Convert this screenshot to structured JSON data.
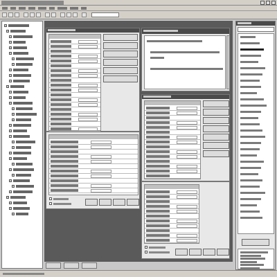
{
  "window": {
    "title": ""
  },
  "menu": {
    "items": [
      "",
      "",
      "",
      "",
      "",
      "",
      "",
      "",
      ""
    ]
  },
  "toolbar": {
    "button_count": 12
  },
  "project_tree": {
    "root": "",
    "nodes": [
      "",
      "",
      "",
      "",
      "",
      "",
      "",
      "",
      "",
      "",
      "",
      "",
      "",
      "",
      "",
      "",
      "",
      "",
      "",
      "",
      "",
      "",
      "",
      "",
      "",
      "",
      "",
      "",
      "",
      "",
      "",
      "",
      "",
      ""
    ]
  },
  "property_panel_top": {
    "title": "",
    "rows": [],
    "buttons": [
      "",
      "",
      "",
      "",
      "",
      ""
    ]
  },
  "property_panel_bottom": {
    "rows": [],
    "buttons": [
      "",
      "",
      "",
      ""
    ]
  },
  "code_editor": {
    "title": "",
    "lines": [
      "",
      "",
      "",
      ""
    ]
  },
  "right_property_panel": {
    "title": "",
    "rows": [],
    "buttons": [
      "",
      "",
      "",
      "",
      "",
      "",
      ""
    ]
  },
  "right_lower_panel": {
    "rows": [],
    "buttons": [
      "",
      "",
      "",
      ""
    ]
  },
  "list_panel": {
    "title": "",
    "items": [
      "",
      "",
      "",
      "",
      "",
      "",
      "",
      "",
      "",
      "",
      "",
      "",
      "",
      "",
      "",
      "",
      "",
      "",
      "",
      "",
      "",
      "",
      "",
      "",
      "",
      "",
      "",
      "",
      "",
      ""
    ],
    "button": ""
  },
  "info_panel": {
    "lines": [
      "",
      "",
      "",
      "",
      "",
      ""
    ]
  },
  "tabs": [
    "",
    "",
    ""
  ],
  "status": {
    "text": ""
  },
  "colors": {
    "window_bg": "#d4d0c8",
    "workspace": "#5a5a5a",
    "panel": "#e8e8e8",
    "header": "#4a4a4a"
  }
}
